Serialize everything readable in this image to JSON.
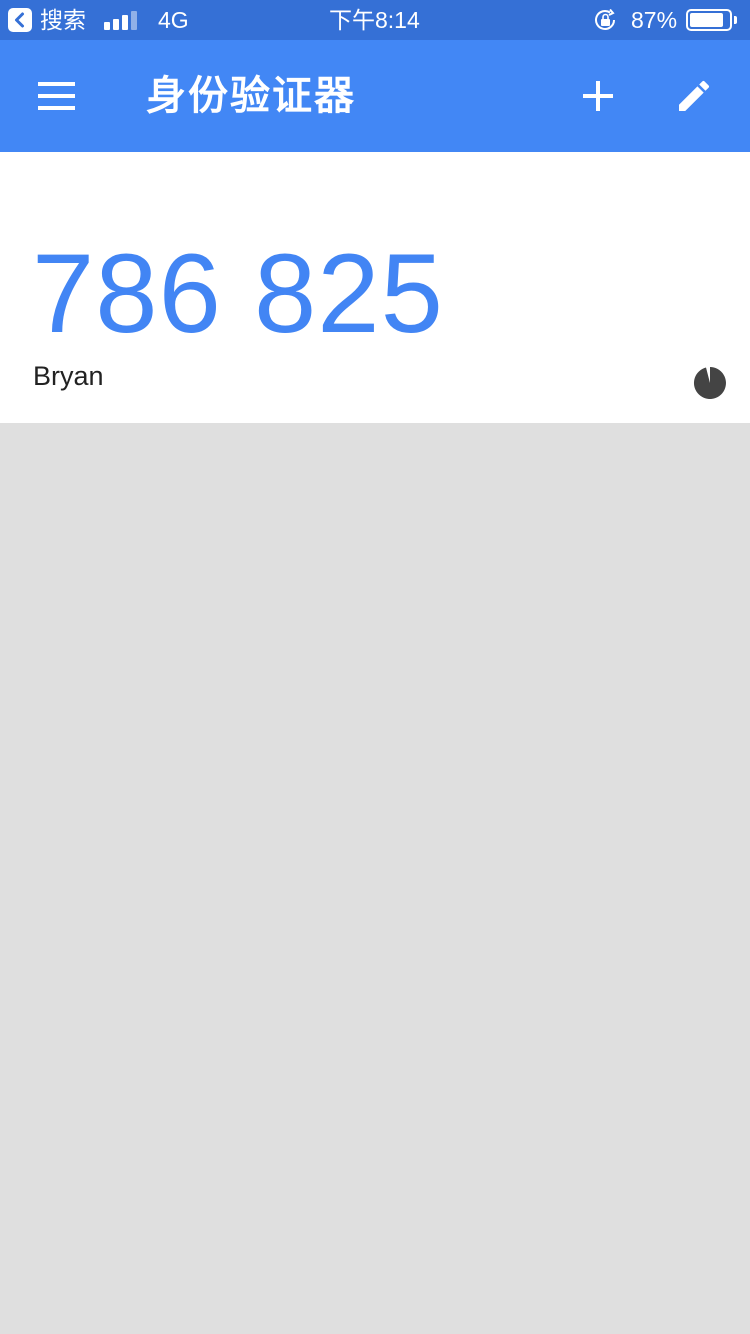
{
  "status_bar": {
    "back_label": "搜索",
    "network": "4G",
    "time": "下午8:14",
    "battery_percent": "87%",
    "battery_level": 0.87,
    "signal_bars": 3,
    "icons": [
      "back-icon",
      "signal-icon",
      "rotation-lock-icon",
      "battery-icon"
    ]
  },
  "app_bar": {
    "title": "身份验证器",
    "icons": [
      "menu-icon",
      "add-icon",
      "edit-icon"
    ],
    "color": "#4287f5"
  },
  "accounts": [
    {
      "code": "786 825",
      "name": "Bryan",
      "timer_icon": "countdown-timer-icon"
    }
  ],
  "colors": {
    "status_bar": "#3570d6",
    "code": "#4285f4",
    "background": "#dfdfdf"
  }
}
